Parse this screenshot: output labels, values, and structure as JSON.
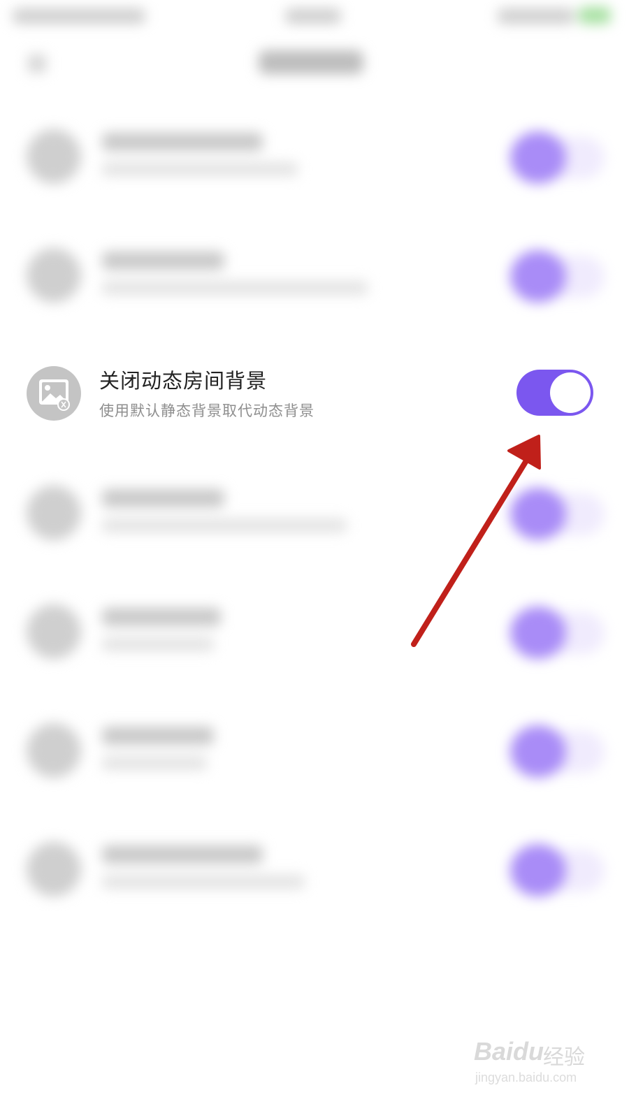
{
  "setting_row": {
    "title": "关闭动态房间背景",
    "subtitle": "使用默认静态背景取代动态背景",
    "toggle_on": true,
    "toggle_color": "#7b57ef"
  },
  "blurred_rows_count_hint": "",
  "watermark": {
    "brand": "Baidu",
    "brand_cn": "经验",
    "url": "jingyan.baidu.com"
  },
  "colors": {
    "accent": "#7b57ef",
    "annotation_arrow": "#c0201a"
  },
  "icons": {
    "row_icon": "image-icon"
  }
}
